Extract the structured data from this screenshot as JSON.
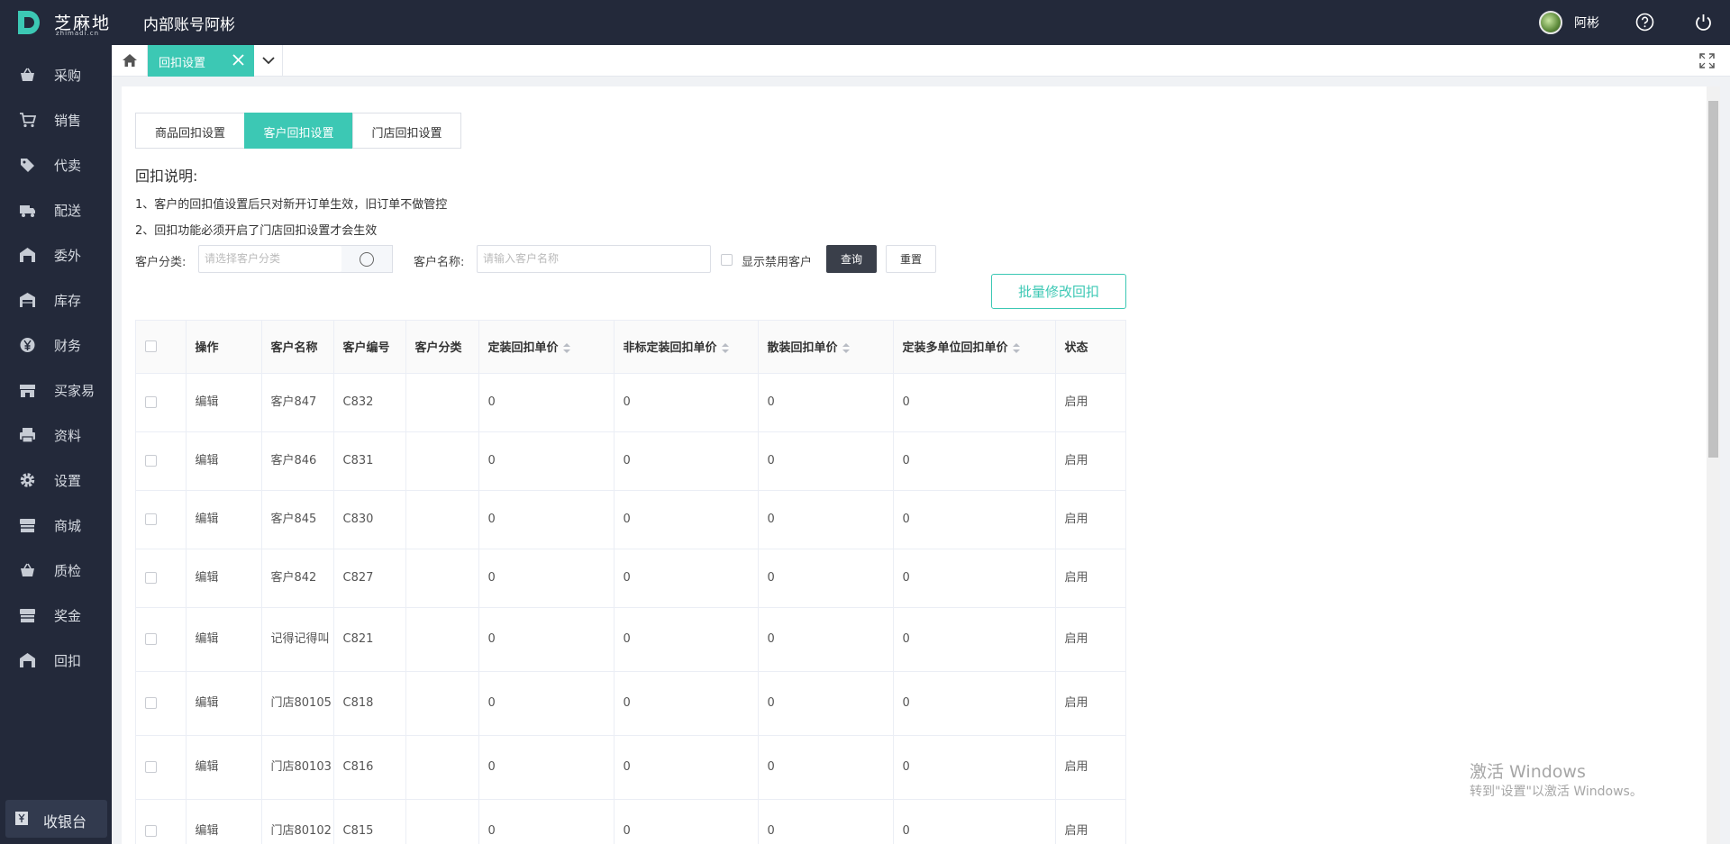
{
  "header": {
    "logo_text": "芝麻地",
    "logo_sub": "zhimadi.cn",
    "account_title": "内部账号阿彬",
    "user_name": "阿彬"
  },
  "sidebar": {
    "items": [
      {
        "label": "采购",
        "icon": "basket-icon"
      },
      {
        "label": "销售",
        "icon": "cart-icon"
      },
      {
        "label": "代卖",
        "icon": "tag-icon"
      },
      {
        "label": "配送",
        "icon": "truck-icon"
      },
      {
        "label": "委外",
        "icon": "warehouse-icon"
      },
      {
        "label": "库存",
        "icon": "storehouse-icon"
      },
      {
        "label": "财务",
        "icon": "yen-icon"
      },
      {
        "label": "买家易",
        "icon": "shop-icon"
      },
      {
        "label": "资料",
        "icon": "printer-icon"
      },
      {
        "label": "设置",
        "icon": "gear-icon"
      },
      {
        "label": "商城",
        "icon": "store-icon"
      },
      {
        "label": "质检",
        "icon": "basket-icon"
      },
      {
        "label": "奖金",
        "icon": "store-icon"
      },
      {
        "label": "回扣",
        "icon": "warehouse-icon"
      }
    ],
    "cashier_label": "收银台"
  },
  "tabbar": {
    "active_tab": "回扣设置"
  },
  "segments": [
    "商品回扣设置",
    "客户回扣设置",
    "门店回扣设置"
  ],
  "description": {
    "title": "回扣说明:",
    "lines": [
      "1、客户的回扣值设置后只对新开订单生效，旧订单不做管控",
      "2、回扣功能必须开启了门店回扣设置才会生效"
    ]
  },
  "filters": {
    "category_label": "客户分类:",
    "category_placeholder": "请选择客户分类",
    "name_label": "客户名称:",
    "name_placeholder": "请输入客户名称",
    "show_disabled_label": "显示禁用客户",
    "query_label": "查询",
    "reset_label": "重置",
    "batch_label": "批量修改回扣"
  },
  "table": {
    "headers": [
      "操作",
      "客户名称",
      "客户编号",
      "客户分类",
      "定装回扣单价",
      "非标定装回扣单价",
      "散装回扣单价",
      "定装多单位回扣单价",
      "状态"
    ],
    "rows": [
      {
        "action": "编辑",
        "name": "客户847",
        "code": "C832",
        "category": "",
        "p1": "0",
        "p2": "0",
        "p3": "0",
        "p4": "0",
        "status": "启用"
      },
      {
        "action": "编辑",
        "name": "客户846",
        "code": "C831",
        "category": "",
        "p1": "0",
        "p2": "0",
        "p3": "0",
        "p4": "0",
        "status": "启用"
      },
      {
        "action": "编辑",
        "name": "客户845",
        "code": "C830",
        "category": "",
        "p1": "0",
        "p2": "0",
        "p3": "0",
        "p4": "0",
        "status": "启用"
      },
      {
        "action": "编辑",
        "name": "客户842",
        "code": "C827",
        "category": "",
        "p1": "0",
        "p2": "0",
        "p3": "0",
        "p4": "0",
        "status": "启用"
      },
      {
        "action": "编辑",
        "name": "记得记得叫",
        "code": "C821",
        "category": "",
        "p1": "0",
        "p2": "0",
        "p3": "0",
        "p4": "0",
        "status": "启用"
      },
      {
        "action": "编辑",
        "name": "门店80105",
        "code": "C818",
        "category": "",
        "p1": "0",
        "p2": "0",
        "p3": "0",
        "p4": "0",
        "status": "启用"
      },
      {
        "action": "编辑",
        "name": "门店80103",
        "code": "C816",
        "category": "",
        "p1": "0",
        "p2": "0",
        "p3": "0",
        "p4": "0",
        "status": "启用"
      },
      {
        "action": "编辑",
        "name": "门店80102",
        "code": "C815",
        "category": "",
        "p1": "0",
        "p2": "0",
        "p3": "0",
        "p4": "0",
        "status": "启用"
      }
    ]
  },
  "watermark": {
    "line1": "激活 Windows",
    "line2": "转到\"设置\"以激活 Windows。"
  }
}
